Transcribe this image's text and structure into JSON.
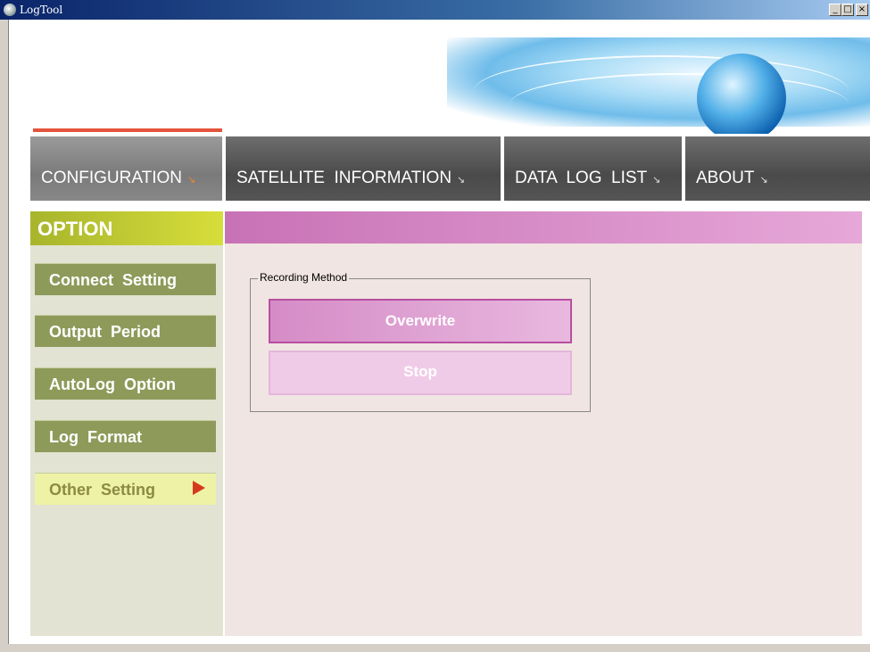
{
  "window": {
    "title": "LogTool",
    "min_label": "_",
    "max_label": "□",
    "close_label": "×"
  },
  "nav": {
    "tabs": [
      {
        "label": "CONFIGURATION",
        "arrow": "↘"
      },
      {
        "label": "SATELLITE  INFORMATION",
        "arrow": "↘"
      },
      {
        "label": "DATA  LOG  LIST",
        "arrow": "↘"
      },
      {
        "label": "ABOUT",
        "arrow": "↘"
      }
    ],
    "active_tab": "CONFIGURATION"
  },
  "sidebar": {
    "header": "OPTION",
    "items": [
      {
        "label": "Connect  Setting"
      },
      {
        "label": "Output  Period"
      },
      {
        "label": "AutoLog  Option"
      },
      {
        "label": "Log  Format"
      },
      {
        "label": "Other  Setting",
        "active": true
      }
    ]
  },
  "main": {
    "group_label": "Recording Method",
    "buttons": [
      {
        "label": "Overwrite",
        "selected": true
      },
      {
        "label": "Stop",
        "selected": false
      }
    ]
  },
  "colors": {
    "accent_line": "#e4533c",
    "sidebar_header": "#c5cf34",
    "main_bar": "#d28cc4",
    "active_arrow": "#d63a1a"
  }
}
